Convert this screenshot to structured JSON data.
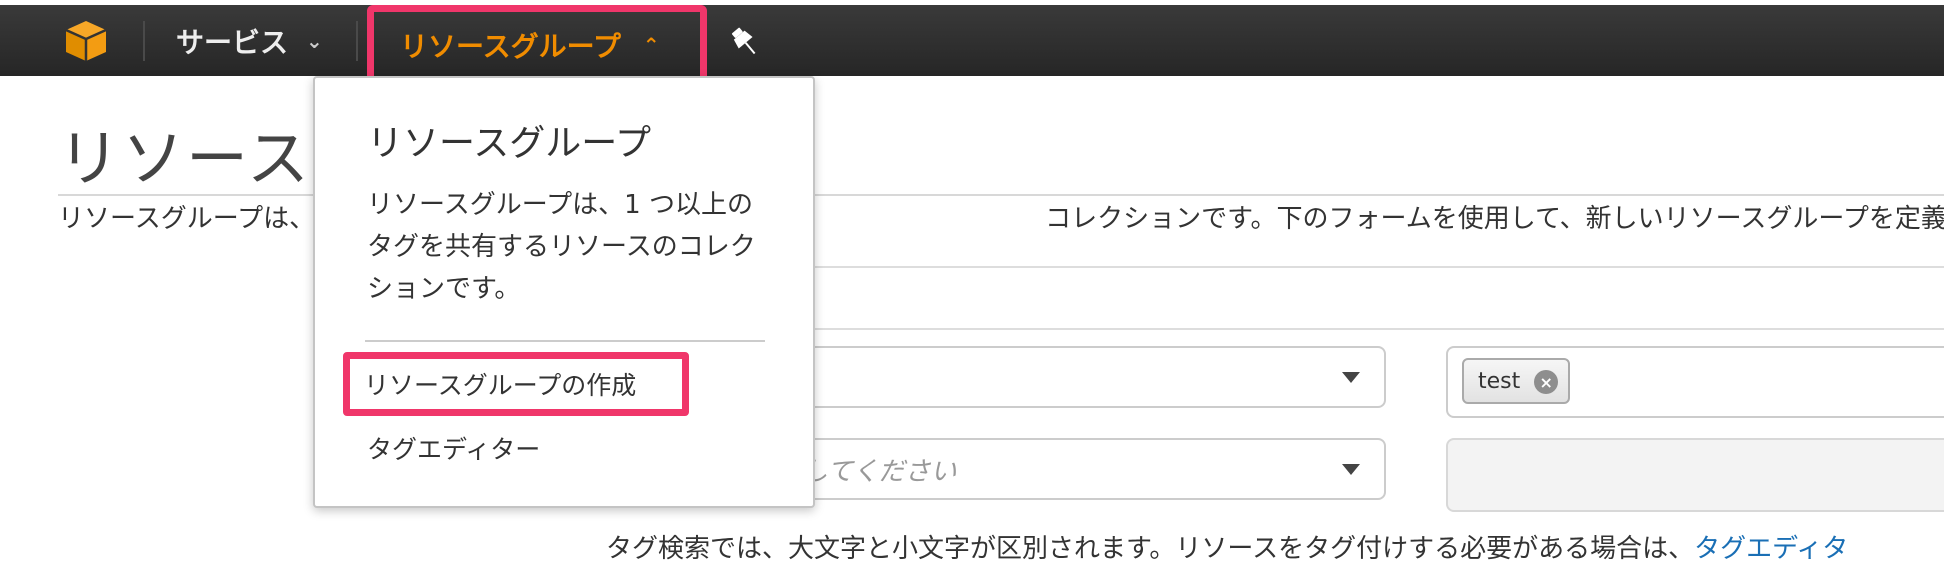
{
  "nav": {
    "services_label": "サービス",
    "resource_groups_label": "リソースグループ",
    "accent_color": "#f08c00",
    "highlight_color": "#f0366a",
    "icons": [
      "aws-cube-icon",
      "chevron-down-icon",
      "chevron-up-icon",
      "pin-icon"
    ]
  },
  "page": {
    "title": "リソースグループ",
    "intro_prefix": "リソースグループは、",
    "intro_suffix": "コレクションです。下のフォームを使用して、新しいリソースグループを定義します。リソ",
    "select2_placeholder": "してください",
    "tag_chip": "test",
    "hint_text": "タグ検索では、大文字と小文字が区別されます。リソースをタグ付けする必要がある場合は、",
    "hint_link": "タグエディタ"
  },
  "dropdown": {
    "title": "リソースグループ",
    "description": "リソースグループは、1 つ以上のタグを共有するリソースのコレクションです。",
    "create_label": "リソースグループの作成",
    "tag_editor_label": "タグエディター"
  }
}
